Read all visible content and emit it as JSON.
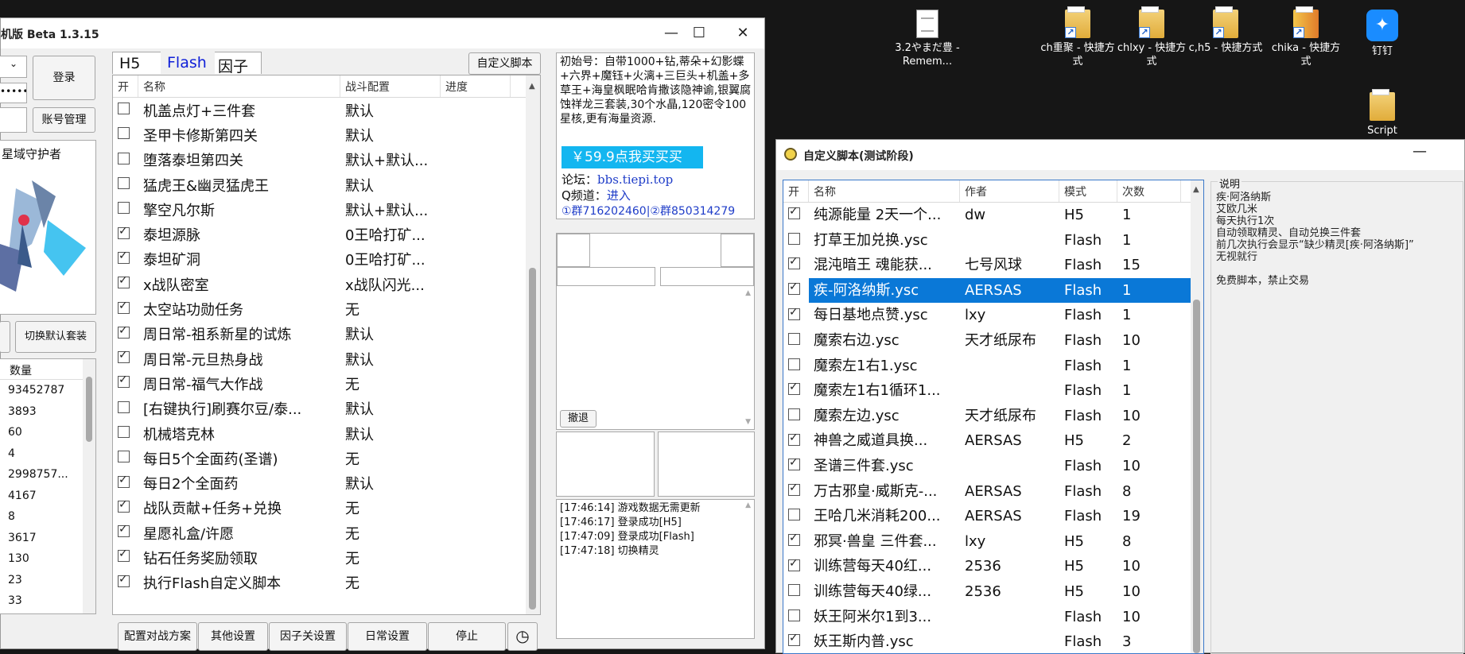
{
  "desktop": {
    "icons": [
      {
        "label": "3.2やまだ豊 - Remem...",
        "icon": "document-icon"
      },
      {
        "label": "ch重聚 - 快捷方式",
        "icon": "shortcut-icon"
      },
      {
        "label": "chlxy - 快捷方式",
        "icon": "shortcut-icon"
      },
      {
        "label": "c,h5 - 快捷方式",
        "icon": "shortcut-icon"
      },
      {
        "label": "chika - 快捷方式",
        "icon": "shortcut-icon"
      },
      {
        "label": "钉钉",
        "icon": "dingtalk-icon"
      },
      {
        "label": "Script",
        "icon": "folder-icon"
      }
    ]
  },
  "main_window": {
    "title": "机版 Beta 1.3.15",
    "controls": {
      "minimize": "—",
      "maximize": "☐",
      "close": "✕"
    },
    "left": {
      "password_mask": "••••••",
      "login": "登录",
      "account_manage": "账号管理",
      "pet_name": "星域守护者",
      "switch_default": "切换默认套装",
      "qty_header": "数量",
      "quantities": [
        "93452787",
        "3893",
        "60",
        "4",
        "2998757...",
        "4167",
        "8",
        "3617",
        "130",
        "23",
        "33"
      ]
    },
    "tabs": [
      "H5",
      "Flash",
      "因子"
    ],
    "custom_script_btn": "自定义脚本",
    "columns": [
      "开",
      "名称",
      "战斗配置",
      "进度"
    ],
    "tasks": [
      {
        "checked": false,
        "name": "机盖点灯+三件套",
        "config": "默认"
      },
      {
        "checked": false,
        "name": "圣甲卡修斯第四关",
        "config": "默认"
      },
      {
        "checked": false,
        "name": "堕落泰坦第四关",
        "config": "默认+默认..."
      },
      {
        "checked": false,
        "name": "猛虎王&幽灵猛虎王",
        "config": "默认"
      },
      {
        "checked": false,
        "name": "擎空凡尔斯",
        "config": "默认+默认..."
      },
      {
        "checked": true,
        "name": "泰坦源脉",
        "config": "0王哈打矿..."
      },
      {
        "checked": true,
        "name": "泰坦矿洞",
        "config": "0王哈打矿..."
      },
      {
        "checked": true,
        "name": "x战队密室",
        "config": "x战队闪光..."
      },
      {
        "checked": true,
        "name": "太空站功勋任务",
        "config": "无"
      },
      {
        "checked": true,
        "name": "周日常-祖系新星的试炼",
        "config": "默认"
      },
      {
        "checked": true,
        "name": "周日常-元旦热身战",
        "config": "默认"
      },
      {
        "checked": true,
        "name": "周日常-福气大作战",
        "config": "无"
      },
      {
        "checked": false,
        "name": "[右键执行]刷赛尔豆/泰...",
        "config": "默认"
      },
      {
        "checked": false,
        "name": "机械塔克林",
        "config": "默认"
      },
      {
        "checked": false,
        "name": "每日5个全面药(圣谱)",
        "config": "无"
      },
      {
        "checked": true,
        "name": "每日2个全面药",
        "config": "默认"
      },
      {
        "checked": true,
        "name": "战队贡献+任务+兑换",
        "config": "无"
      },
      {
        "checked": true,
        "name": "星愿礼盒/许愿",
        "config": "无"
      },
      {
        "checked": true,
        "name": "钻石任务奖励领取",
        "config": "无"
      },
      {
        "checked": true,
        "name": "执行Flash自定义脚本",
        "config": "无"
      }
    ],
    "bottom_buttons": [
      "配置对战方案",
      "其他设置",
      "因子关设置",
      "日常设置",
      "停止"
    ],
    "ad": {
      "text": "初始号：自带1000+钻,蒂朵+幻影蝶+六界+魔钰+火漓+三巨头+机盖+多草王+海皇枫眠哈肯撒该隐神谕,银翼腐蚀祥龙三套装,30个水晶,120密令100星核,更有海量资源.",
      "buy": "￥59.9点我买买买",
      "forum_label": "论坛：",
      "forum_link": "bbs.tiepi.top",
      "qq_label": "Q频道：",
      "qq_link": "进入",
      "groups": "①群716202460|②群850314279"
    },
    "undo": "撤退",
    "log": [
      "[17:46:14] 游戏数据无需更新",
      "[17:46:17] 登录成功[H5]",
      "[17:47:09] 登录成功[Flash]",
      "[17:47:18] 切换精灵"
    ]
  },
  "custom_window": {
    "title": "自定义脚本(测试阶段)",
    "close": "—",
    "columns": [
      "开",
      "名称",
      "作者",
      "模式",
      "次数"
    ],
    "scripts": [
      {
        "checked": true,
        "name": "纯源能量 2天一个...",
        "author": "dw",
        "mode": "H5",
        "count": "1"
      },
      {
        "checked": false,
        "name": "打草王加兑换.ysc",
        "author": "",
        "mode": "Flash",
        "count": "1"
      },
      {
        "checked": true,
        "name": "混沌暗王 魂能获...",
        "author": "七号风球",
        "mode": "Flash",
        "count": "15"
      },
      {
        "checked": true,
        "name": "疾-阿洛纳斯.ysc",
        "author": "AERSAS",
        "mode": "Flash",
        "count": "1",
        "selected": true
      },
      {
        "checked": true,
        "name": "每日基地点赞.ysc",
        "author": "lxy",
        "mode": "Flash",
        "count": "1"
      },
      {
        "checked": false,
        "name": "魔索右边.ysc",
        "author": "天才纸尿布",
        "mode": "Flash",
        "count": "10"
      },
      {
        "checked": false,
        "name": "魔索左1右1.ysc",
        "author": "",
        "mode": "Flash",
        "count": "1"
      },
      {
        "checked": true,
        "name": "魔索左1右1循环1...",
        "author": "",
        "mode": "Flash",
        "count": "1"
      },
      {
        "checked": false,
        "name": "魔索左边.ysc",
        "author": "天才纸尿布",
        "mode": "Flash",
        "count": "10"
      },
      {
        "checked": true,
        "name": "神兽之威道具换...",
        "author": "AERSAS",
        "mode": "H5",
        "count": "2"
      },
      {
        "checked": true,
        "name": "圣谱三件套.ysc",
        "author": "",
        "mode": "Flash",
        "count": "10"
      },
      {
        "checked": true,
        "name": "万古邪皇·威斯克-...",
        "author": "AERSAS",
        "mode": "Flash",
        "count": "8"
      },
      {
        "checked": false,
        "name": "王哈几米消耗200...",
        "author": "AERSAS",
        "mode": "Flash",
        "count": "19"
      },
      {
        "checked": true,
        "name": "邪冥·兽皇 三件套...",
        "author": "lxy",
        "mode": "H5",
        "count": "8"
      },
      {
        "checked": true,
        "name": "训练营每天40红...",
        "author": "2536",
        "mode": "H5",
        "count": "10"
      },
      {
        "checked": false,
        "name": "训练营每天40绿...",
        "author": "2536",
        "mode": "H5",
        "count": "10"
      },
      {
        "checked": false,
        "name": "妖王阿米尔1到3...",
        "author": "",
        "mode": "Flash",
        "count": "10"
      },
      {
        "checked": true,
        "name": "妖王斯内普.ysc",
        "author": "",
        "mode": "Flash",
        "count": "3"
      }
    ],
    "desc_title": "说明",
    "desc_lines": [
      "疾·阿洛纳斯",
      "艾欧几米",
      "每天执行1次",
      "自动领取精灵、自动兑换三件套",
      "前几次执行会显示“缺少精灵[疾·阿洛纳斯]”",
      "无视就行",
      "",
      "免费脚本，禁止交易"
    ]
  }
}
